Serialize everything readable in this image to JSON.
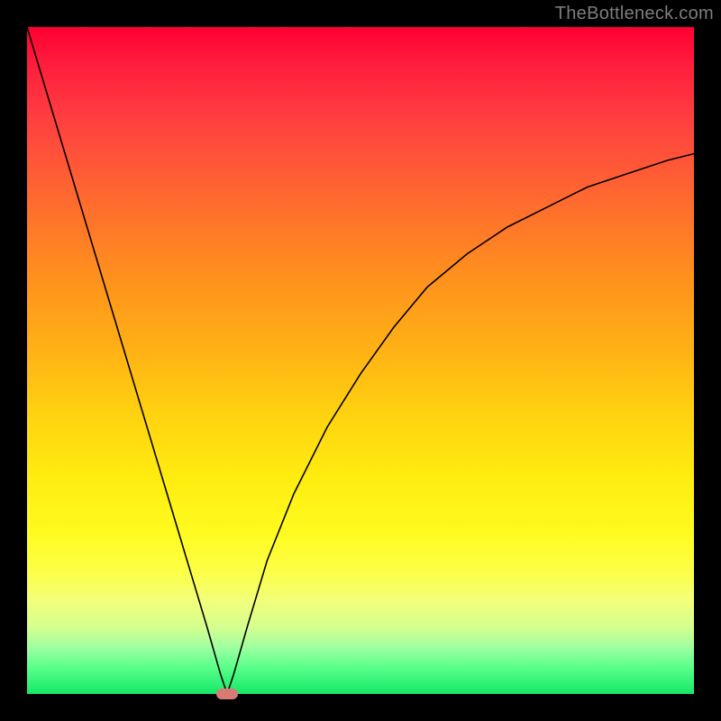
{
  "watermark": "TheBottleneck.com",
  "chart_data": {
    "type": "line",
    "title": "",
    "xlabel": "",
    "ylabel": "",
    "xlim": [
      0,
      100
    ],
    "ylim": [
      0,
      100
    ],
    "background_gradient": {
      "top": "#ff0033",
      "bottom": "#14e869",
      "direction": "vertical",
      "meaning": "severity scale (red high to green low)"
    },
    "series": [
      {
        "name": "bottleneck-curve",
        "x": [
          0,
          3,
          6,
          9,
          12,
          15,
          18,
          21,
          24,
          27,
          29,
          30,
          31,
          33,
          36,
          40,
          45,
          50,
          55,
          60,
          66,
          72,
          78,
          84,
          90,
          96,
          100
        ],
        "values": [
          100,
          90,
          80,
          70,
          60,
          50,
          40,
          30,
          20,
          10,
          3,
          0,
          3,
          10,
          20,
          30,
          40,
          48,
          55,
          61,
          66,
          70,
          73,
          76,
          78,
          80,
          81
        ]
      }
    ],
    "marker": {
      "x": 30,
      "y": 0,
      "color": "#d87a76"
    },
    "grid": false,
    "legend": false
  }
}
